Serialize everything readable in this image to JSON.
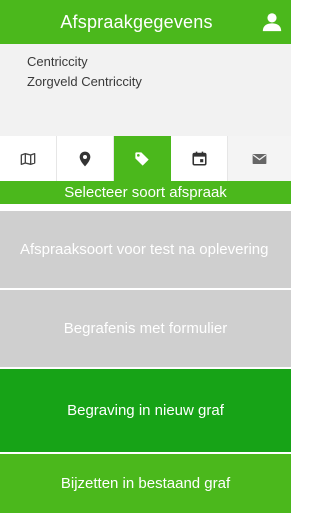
{
  "header": {
    "title": "Afspraakgegevens",
    "user_icon": "user-icon"
  },
  "info": {
    "line1": "Centriccity",
    "line2": "Zorgveld Centriccity"
  },
  "tabs": [
    {
      "icon": "map-icon",
      "active": false
    },
    {
      "icon": "location-pin-icon",
      "active": false
    },
    {
      "icon": "tag-icon",
      "active": true
    },
    {
      "icon": "calendar-icon",
      "active": false
    },
    {
      "icon": "mail-icon",
      "active": false
    }
  ],
  "section": {
    "label": "Selecteer soort afspraak"
  },
  "options": [
    {
      "label": "Afspraaksoort voor test na oplevering",
      "state": "disabled"
    },
    {
      "label": "Begrafenis met formulier",
      "state": "disabled"
    },
    {
      "label": "Begraving in nieuw graf",
      "state": "selected"
    },
    {
      "label": "Bijzetten in bestaand graf",
      "state": "available"
    }
  ],
  "colors": {
    "primary_green": "#4bb81c",
    "selected_green": "#17a317",
    "disabled_gray": "#cfcfcf",
    "info_background": "#f2f2f2"
  }
}
